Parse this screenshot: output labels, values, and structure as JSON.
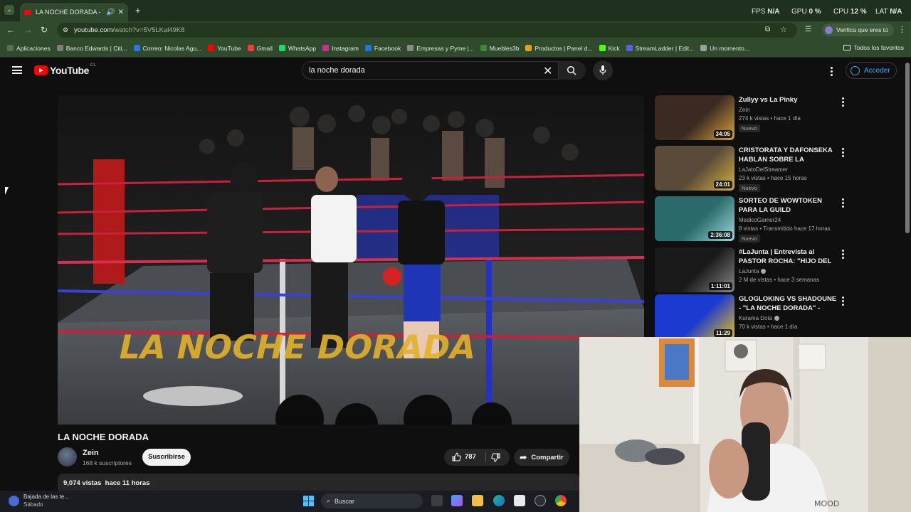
{
  "browser": {
    "tab_title": "LA NOCHE DORADA - YouTube",
    "url_host": "youtube.com",
    "url_path": "/watch?v=5V5LKal49K8",
    "profile_chip": "Verifica que eres tú",
    "stats": {
      "fps_label": "FPS",
      "fps_value": "N/A",
      "gpu_label": "GPU",
      "gpu_value": "0 %",
      "cpu_label": "CPU",
      "cpu_value": "12 %",
      "lat_label": "LAT",
      "lat_value": "N/A"
    },
    "bookmarks": [
      {
        "label": "Aplicaciones",
        "color": "#5a6b58"
      },
      {
        "label": "Banco Edwards | Citi...",
        "color": "#7d7d7d"
      },
      {
        "label": "Correo: Nicolas Agu...",
        "color": "#2b79d8"
      },
      {
        "label": "YouTube",
        "color": "#ff0000"
      },
      {
        "label": "Gmail",
        "color": "#ea4335"
      },
      {
        "label": "WhatsApp",
        "color": "#25d366"
      },
      {
        "label": "Instagram",
        "color": "#d6249f"
      },
      {
        "label": "Facebook",
        "color": "#1877f2"
      },
      {
        "label": "Empresas y Pyme |...",
        "color": "#8a8a8a"
      },
      {
        "label": "Muebles3b",
        "color": "#3d8a3d"
      },
      {
        "label": "Productos | Panel d...",
        "color": "#e0a020"
      },
      {
        "label": "Kick",
        "color": "#53fc18"
      },
      {
        "label": "StreamLadder | Edit...",
        "color": "#5b5fe0"
      },
      {
        "label": "Un momento...",
        "color": "#9aa0a6"
      }
    ],
    "all_bookmarks": "Todos los favoritos"
  },
  "youtube": {
    "logo_text": "YouTube",
    "country_code": "CL",
    "search_value": "la noche dorada",
    "login_label": "Acceder"
  },
  "video": {
    "title": "LA NOCHE DORADA",
    "channel": "Zein",
    "subscribers": "168 k suscriptores",
    "subscribe_label": "Suscribirse",
    "likes": "787",
    "share_label": "Compartir",
    "views": "9,074 vistas",
    "age": "hace 11 horas"
  },
  "recommendations": [
    {
      "title": "Zullyy vs La Pinky",
      "channel": "Zein",
      "meta": "274 k vistas • hace 1 día",
      "badge": "Nuevo",
      "duration": "34:05",
      "verified": false
    },
    {
      "title": "CRISTORATA Y DAFONSEKA HABLAN SOBRE LA DERROTA ...",
      "channel": "LaJatoDelStreamer",
      "meta": "23 k vistas • hace 15 horas",
      "badge": "Nuevo",
      "duration": "24:01",
      "verified": false
    },
    {
      "title": "SORTEO DE WOWTOKEN PARA LA GUILD",
      "channel": "MedicoGamer24",
      "meta": "8 vistas • Transmitido hace 17 horas",
      "badge": "Nuevo",
      "duration": "2:36:08",
      "verified": false
    },
    {
      "title": "#LaJunta | Entrevista al PASTOR ROCHA: \"HIJO DEL J...",
      "channel": "LaJunta",
      "meta": "2 M de vistas • hace 3 semanas",
      "badge": "",
      "duration": "1:11:01",
      "verified": true
    },
    {
      "title": "GLOGLOKING VS SHADOUNE - \"LA NOCHE DORADA\" - ELZEEI...",
      "channel": "Kurama Dota",
      "meta": "70 k vistas • hace 1 día",
      "badge": "",
      "duration": "11:29",
      "verified": true
    }
  ],
  "taskbar": {
    "widget_title": "Bajada de las te...",
    "widget_sub": "Sábado",
    "search_label": "Buscar"
  },
  "colors": {
    "browser_frame": "#2f4a2c",
    "youtube_bg": "#0f0f0f",
    "accent_blue": "#3ea6ff",
    "youtube_red": "#ff0000"
  }
}
